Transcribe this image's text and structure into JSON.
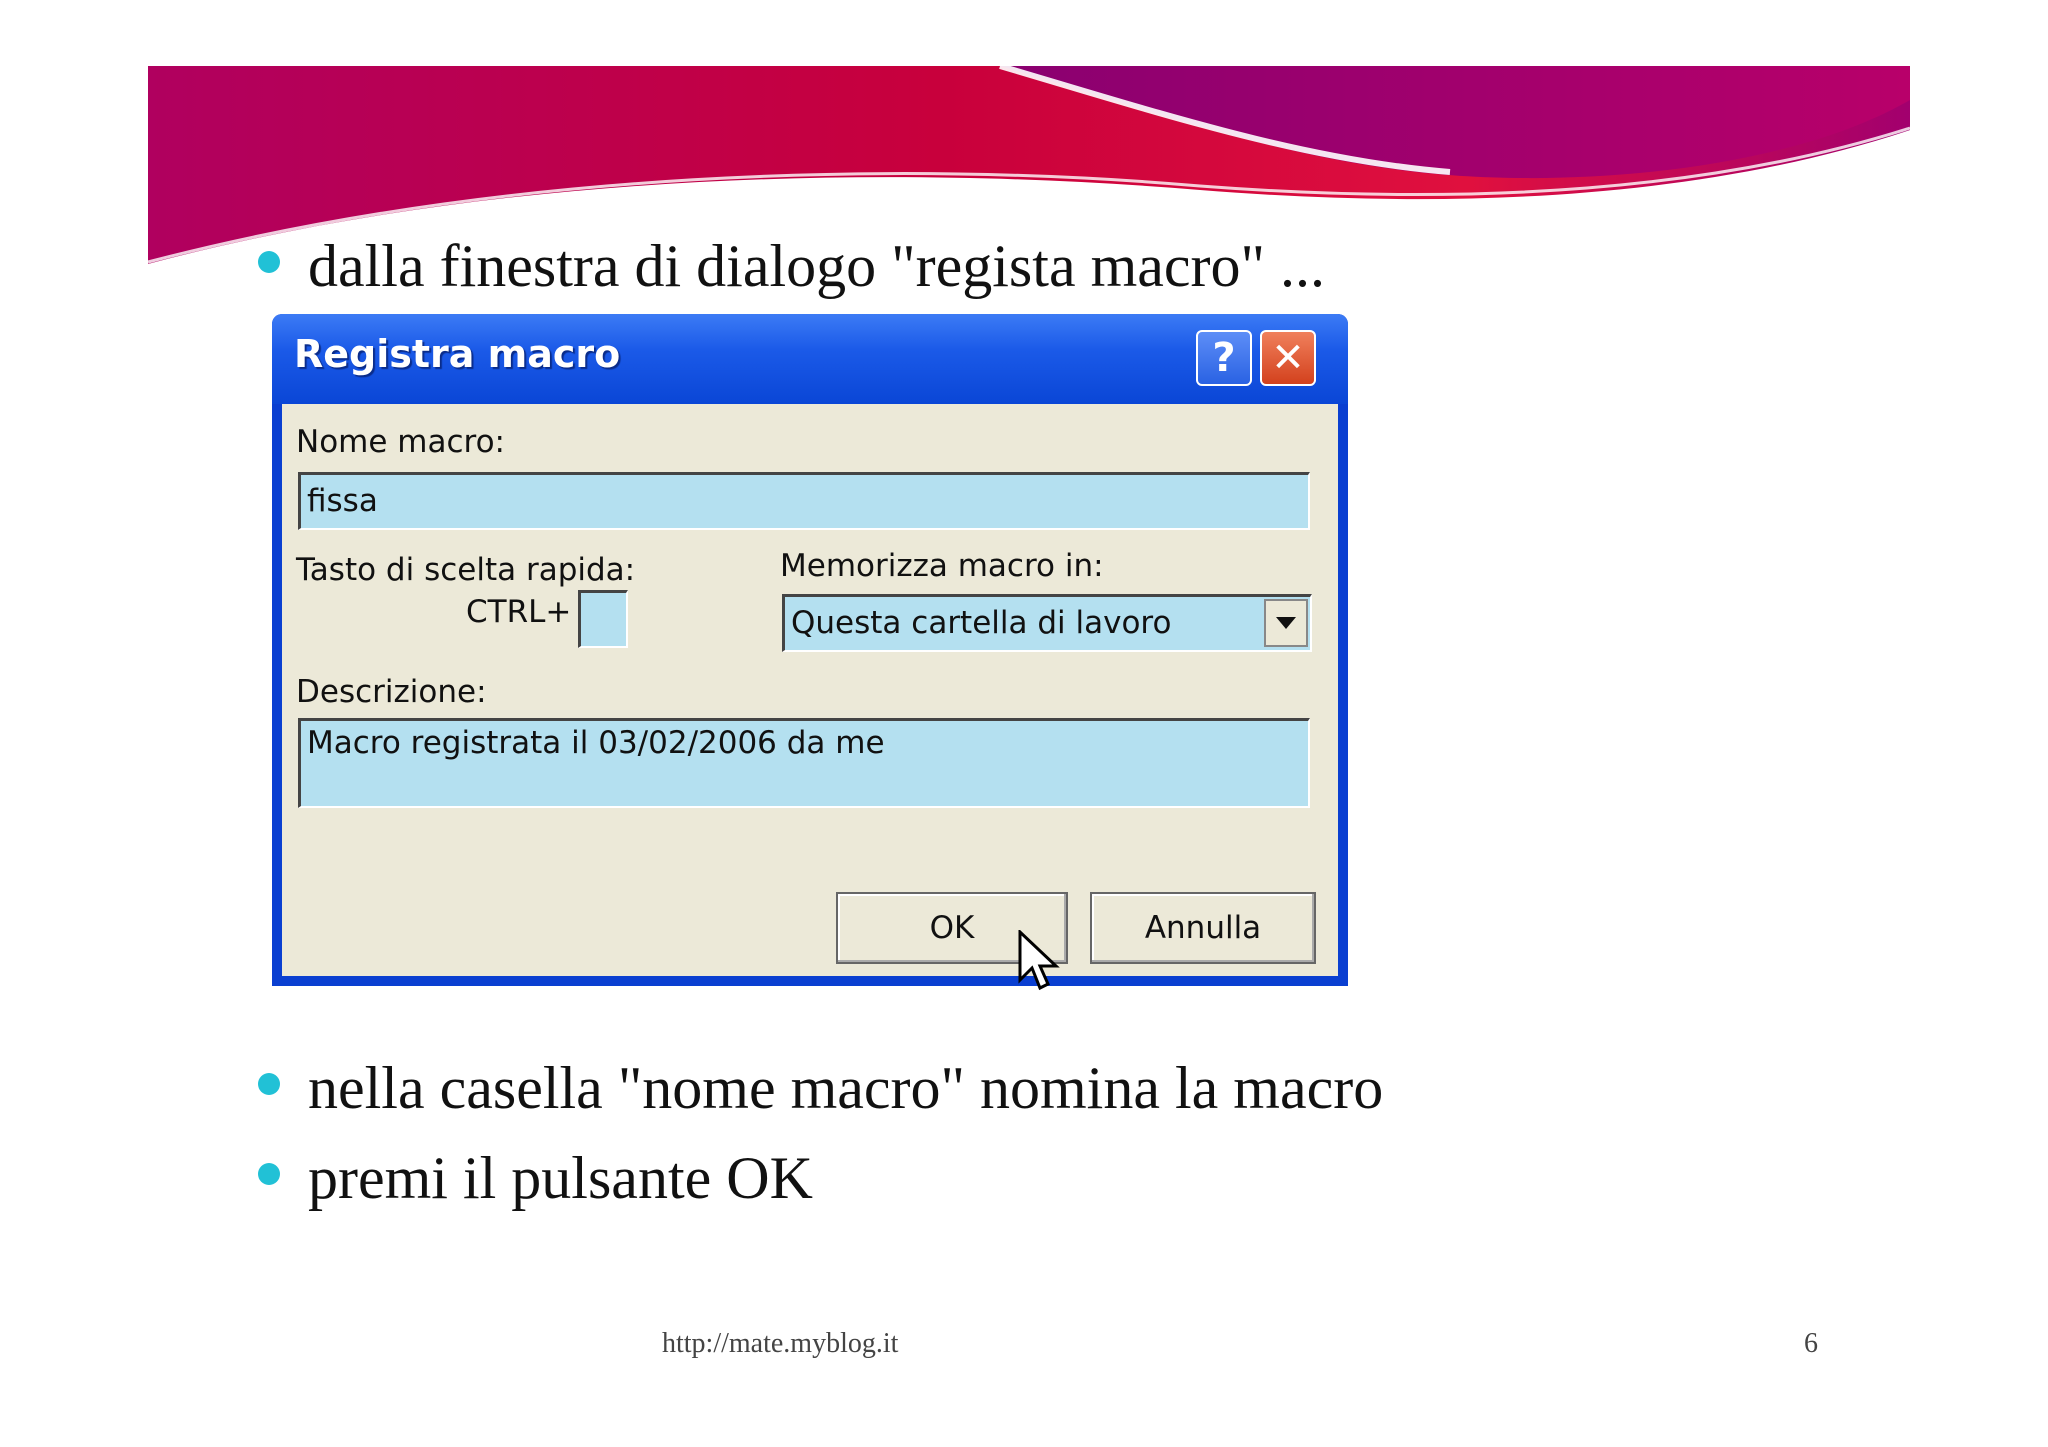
{
  "slide": {
    "bullets": [
      "dalla finestra di dialogo \"regista macro\" ...",
      "nella casella \"nome macro\" nomina la macro",
      "premi il pulsante OK"
    ],
    "footer_url": "http://mate.myblog.it",
    "page_number": "6"
  },
  "dialog": {
    "title": "Registra macro",
    "help_label": "?",
    "close_label": "✕",
    "name_label": "Nome macro:",
    "name_value": "fissa",
    "shortcut_label": "Tasto di scelta rapida:",
    "ctrl_label": "CTRL+",
    "shortcut_value": "",
    "store_label": "Memorizza macro in:",
    "store_value": "Questa cartella di lavoro",
    "description_label": "Descrizione:",
    "description_value": "Macro registrata il 03/02/2006 da me",
    "ok_label": "OK",
    "cancel_label": "Annulla"
  },
  "colors": {
    "bullet": "#21c1d6",
    "titlebar": "#0a46d6",
    "field_bg": "#b4e0f0",
    "dialog_bg": "#ece9d8"
  }
}
